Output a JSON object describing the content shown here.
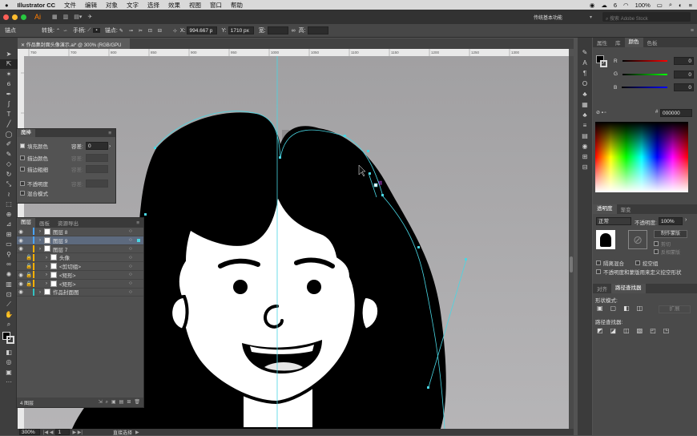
{
  "menubar": {
    "app": "Illustrator CC",
    "items": [
      "文件",
      "编辑",
      "对象",
      "文字",
      "选择",
      "效果",
      "视图",
      "窗口",
      "帮助"
    ],
    "battery": "100%",
    "clock": "6"
  },
  "appbar": {
    "logo": "Ai",
    "workspace": "传统基本功能",
    "search_placeholder": "搜索 Adobe Stock"
  },
  "control": {
    "mode_label": "锚点",
    "convert_label": "转换:",
    "handles_label": "手柄:",
    "anchor_label": "锚点:",
    "x_value": "994.667 p",
    "y_value": "1710 px",
    "width_label": "宽:",
    "height_label": "高:"
  },
  "document": {
    "tab_title": "作品集封面头像演示.ai* @ 300% (RGB/GPU 预览)",
    "zoom": "300%",
    "artboard": "1",
    "tool_status": "直接选择"
  },
  "ruler": {
    "ticks": [
      "750",
      "700",
      "800",
      "850",
      "900",
      "950",
      "1000",
      "1050",
      "1100",
      "1150",
      "1200",
      "1250",
      "1300"
    ]
  },
  "magic_wand": {
    "title": "魔棒",
    "fill_label": "填充颜色",
    "tolerance_label": "容差:",
    "tolerance_value": "0",
    "stroke_color_label": "描边颜色",
    "stroke_weight_label": "描边粗细",
    "opacity_label": "不透明度",
    "blend_label": "混合模式"
  },
  "layers": {
    "tabs": [
      "图层",
      "画板",
      "资源导出"
    ],
    "rows": [
      {
        "name": "图层 8",
        "indent": 0,
        "color": "#4aa3ff",
        "eye": true,
        "lock": false,
        "sel": false
      },
      {
        "name": "图层 9",
        "indent": 0,
        "color": "#4aa3ff",
        "eye": true,
        "lock": false,
        "sel": true
      },
      {
        "name": "图层 7",
        "indent": 0,
        "color": "#ffb000",
        "eye": true,
        "lock": false,
        "sel": false
      },
      {
        "name": "头像",
        "indent": 1,
        "color": "#ffb000",
        "eye": false,
        "lock": true,
        "sel": false
      },
      {
        "name": "<剪切组>",
        "indent": 1,
        "color": "#ffb000",
        "eye": false,
        "lock": true,
        "sel": false
      },
      {
        "name": "<矩形>",
        "indent": 1,
        "color": "#ffb000",
        "eye": true,
        "lock": true,
        "sel": false
      },
      {
        "name": "<矩形>",
        "indent": 1,
        "color": "#ffb000",
        "eye": true,
        "lock": true,
        "sel": false
      },
      {
        "name": "作品封面图",
        "indent": 0,
        "color": "#33c1c1",
        "eye": true,
        "lock": false,
        "sel": false
      }
    ],
    "count": "4 图层"
  },
  "color_panel": {
    "tabs": [
      "属性",
      "库",
      "颜色",
      "色板"
    ],
    "r": "0",
    "g": "0",
    "b": "0",
    "hex": "000000",
    "r_label": "R",
    "g_label": "G",
    "b_label": "B"
  },
  "transparency": {
    "tabs": [
      "透明度",
      "渐变"
    ],
    "mode": "正常",
    "opacity_label": "不透明度:",
    "opacity": "100%",
    "make_mask": "制作蒙版",
    "clip": "剪切",
    "invert": "反相蒙版",
    "isolate": "隔离混合",
    "knockout": "挖空组",
    "opacity_mask": "不透明度和蒙版用来定义挖空形状"
  },
  "pathfinder": {
    "tabs": [
      "对齐",
      "路径查找器"
    ],
    "shape_modes": "形状模式:",
    "expand": "扩展",
    "pathfinders": "路径查找器:"
  }
}
